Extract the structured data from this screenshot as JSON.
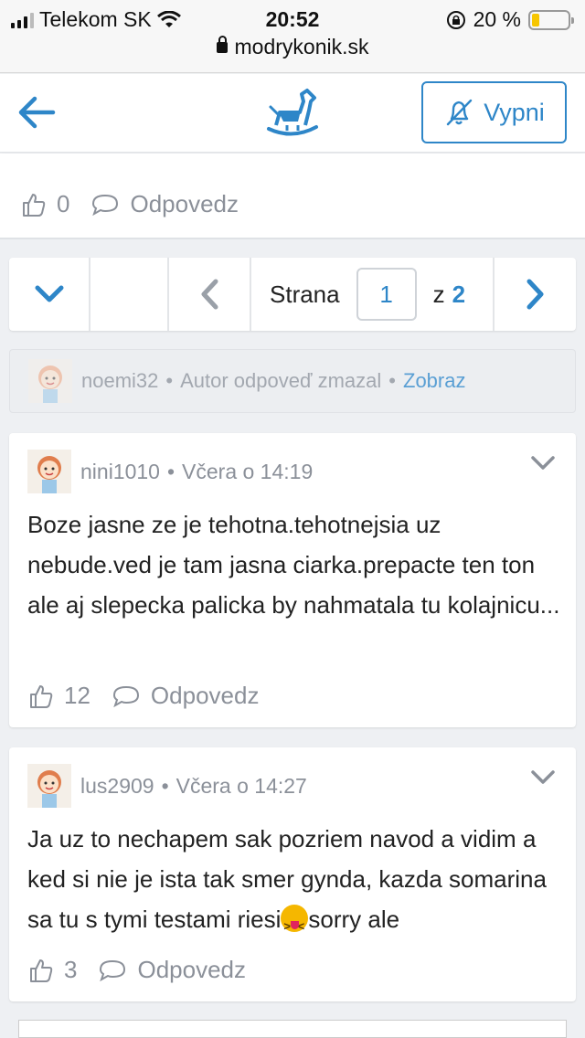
{
  "status_bar": {
    "carrier": "Telekom SK",
    "time": "20:52",
    "battery": "20 %",
    "battery_level": 0.2,
    "url": "modrykonik.sk"
  },
  "header": {
    "mute_label": "Vypni",
    "back_icon": "arrow-left-icon",
    "logo_icon": "rocking-horse-icon",
    "mute_icon": "bell-off-icon"
  },
  "top_post": {
    "likes": "0",
    "reply_label": "Odpovedz"
  },
  "pagination": {
    "label": "Strana",
    "current": "1",
    "of": "z",
    "total": "2"
  },
  "deleted_notice": {
    "user": "noemi32",
    "message": "Autor odpoveď zmazal",
    "link": "Zobraz"
  },
  "posts": [
    {
      "user": "nini1010",
      "time": "Včera o 14:19",
      "text": "Boze jasne ze je tehotna.tehotnejsia uz nebude.ved je tam jasna ciarka.prepacte ten ton ale aj slepecka palicka by nahmatala tu kolajnicu...",
      "likes": "12",
      "reply_label": "Odpovedz"
    },
    {
      "user": "lus2909",
      "time": "Včera o 14:27",
      "text_before": "Ja uz to nechapem sak pozriem navod a vidim a ked si nie je ista tak smer gynda, kazda somarina sa tu s tymi testami riesi",
      "text_after": "sorry ale",
      "likes": "3",
      "reply_label": "Odpovedz"
    }
  ],
  "colors": {
    "accent": "#2e86c8",
    "muted_text": "#8b9099",
    "background": "#eef0f3",
    "battery": "#f7c600"
  }
}
